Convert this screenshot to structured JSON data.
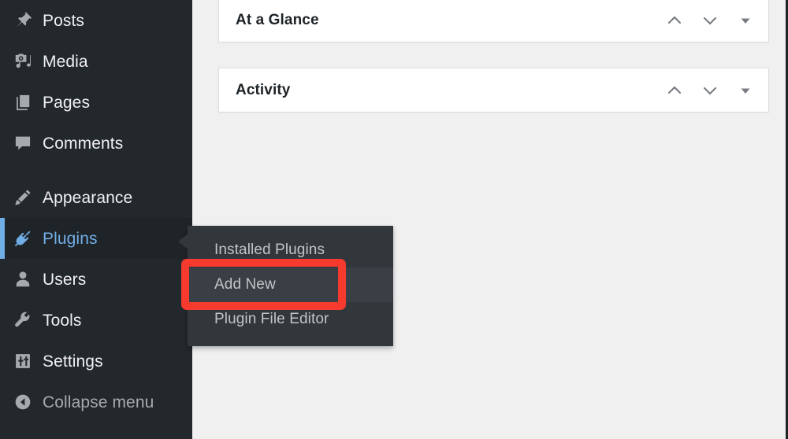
{
  "colors": {
    "sidebar_bg": "#23282d",
    "sidebar_active_bg": "#1f2428",
    "accent_blue": "#72aee6",
    "flyout_bg": "#32373c",
    "flyout_hl_bg": "#3a3f45",
    "highlight_red": "#f63a2e",
    "content_bg": "#f0f0f1",
    "widget_bg": "#ffffff",
    "text_light": "#f0f0f1",
    "text_muted": "#a7aaad",
    "text_dark": "#1d2327"
  },
  "sidebar": {
    "items": [
      {
        "label": "Posts",
        "icon": "pushpin-icon",
        "state": "default"
      },
      {
        "label": "Media",
        "icon": "media-icon",
        "state": "default"
      },
      {
        "label": "Pages",
        "icon": "pages-icon",
        "state": "default"
      },
      {
        "label": "Comments",
        "icon": "comment-icon",
        "state": "default"
      },
      {
        "label": "Appearance",
        "icon": "paintbrush-icon",
        "state": "default"
      },
      {
        "label": "Plugins",
        "icon": "plug-icon",
        "state": "current"
      },
      {
        "label": "Users",
        "icon": "user-icon",
        "state": "default"
      },
      {
        "label": "Tools",
        "icon": "wrench-icon",
        "state": "default"
      },
      {
        "label": "Settings",
        "icon": "sliders-icon",
        "state": "default"
      },
      {
        "label": "Collapse menu",
        "icon": "arrow-left-circle-icon",
        "state": "dim"
      }
    ]
  },
  "flyout": {
    "parent": "Plugins",
    "items": [
      {
        "label": "Installed Plugins",
        "highlighted": false
      },
      {
        "label": "Add New",
        "highlighted": true
      },
      {
        "label": "Plugin File Editor",
        "highlighted": false
      }
    ]
  },
  "annotation": {
    "target_label": "Add New",
    "color": "#f63a2e",
    "shape": "rounded-rectangle"
  },
  "main": {
    "widgets": [
      {
        "title": "At a Glance",
        "collapsed": true,
        "actions": [
          {
            "name": "move-up",
            "icon": "chevron-up-icon"
          },
          {
            "name": "move-down",
            "icon": "chevron-down-icon"
          },
          {
            "name": "toggle",
            "icon": "triangle-down-icon"
          }
        ]
      },
      {
        "title": "Activity",
        "collapsed": true,
        "actions": [
          {
            "name": "move-up",
            "icon": "chevron-up-icon"
          },
          {
            "name": "move-down",
            "icon": "chevron-down-icon"
          },
          {
            "name": "toggle",
            "icon": "triangle-down-icon"
          }
        ]
      }
    ]
  }
}
